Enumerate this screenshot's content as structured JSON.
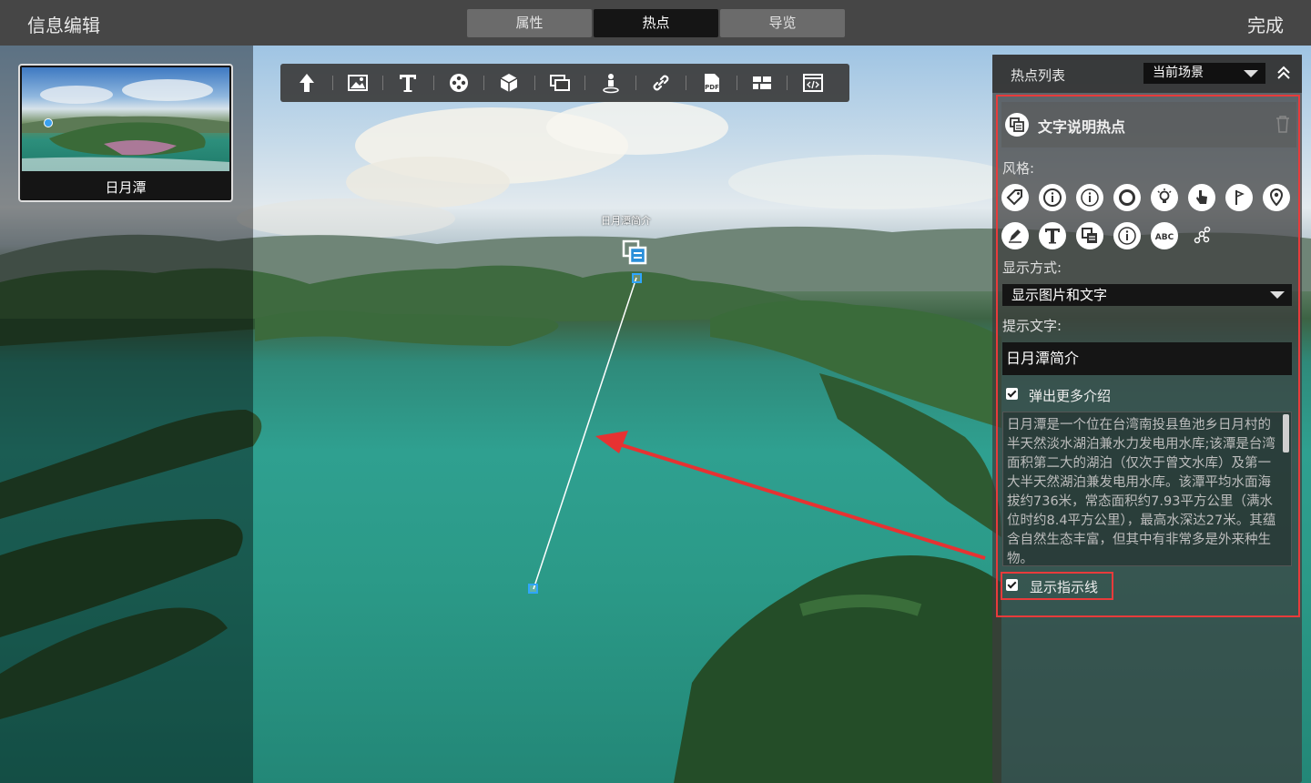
{
  "header": {
    "title": "信息编辑",
    "tabs": [
      "属性",
      "热点",
      "导览"
    ],
    "done": "完成"
  },
  "scene": {
    "name": "日月潭"
  },
  "toolbar": {
    "tools": [
      "arrow-up-icon",
      "image-icon",
      "text-icon",
      "film-icon",
      "cube-icon",
      "layers-icon",
      "person-pin-icon",
      "link-icon",
      "pdf-icon",
      "grid-icon",
      "embed-code-icon"
    ],
    "pdf_text": "PDF"
  },
  "hotspot": {
    "label": "日月潭简介"
  },
  "panel": {
    "title": "热点列表",
    "scene_filter": "当前场景",
    "hotspot_name": "文字说明热点",
    "style_label": "风格:",
    "style_text_abc": "ABC",
    "display_label": "显示方式:",
    "display_value": "显示图片和文字",
    "hint_label": "提示文字:",
    "hint_value": "日月潭简介",
    "popup_label": "弹出更多介绍",
    "description": "日月潭是一个位在台湾南投县鱼池乡日月村的半天然淡水湖泊兼水力发电用水库;该潭是台湾面积第二大的湖泊（仅次于曾文水库）及第一大半天然湖泊兼发电用水库。该潭平均水面海拔约736米，常态面积约7.93平方公里（满水位时约8.4平方公里），最高水深达27米。其蕴含自然生态丰富，但其中有非常多是外来种生物。",
    "show_line_label": "显示指示线"
  },
  "colors": {
    "accent": "#2fa6ff",
    "highlight": "#e83b3b"
  }
}
